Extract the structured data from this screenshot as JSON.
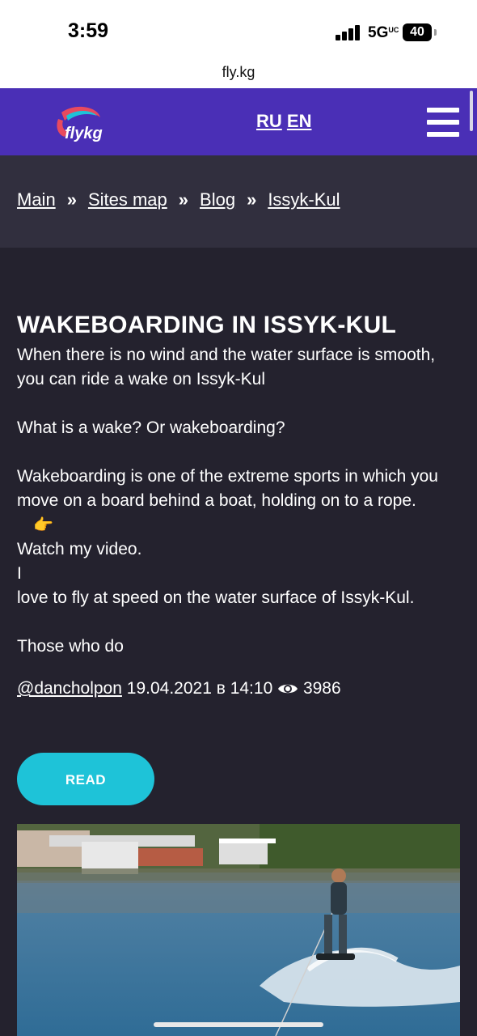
{
  "status_bar": {
    "time": "3:59",
    "network": "5G",
    "network_suffix": "UC",
    "battery": "40"
  },
  "browser": {
    "url": "fly.kg"
  },
  "header": {
    "logo_text": "FLYKG",
    "lang_ru": "RU",
    "lang_en": "EN",
    "menu_icon": "hamburger-menu-icon",
    "bg_color": "#4a2fb6"
  },
  "breadcrumb": {
    "items": [
      "Main",
      "Sites map",
      "Blog",
      "Issyk-Kul"
    ],
    "separator": "»"
  },
  "article": {
    "title": "WAKEBOARDING IN ISSYK-KUL",
    "p1": "When there is no wind and the water surface is smooth, you can ride a wake on Issyk-Kul",
    "p2": "What is a wake? Or wakeboarding?",
    "p3": "Wakeboarding is one of the extreme sports in which you move on a board behind a boat, holding on to a rope.",
    "emoji": "👉",
    "p4": "Watch my video.",
    "p5": "I",
    "p6": "love to fly at speed on the water surface of Issyk-Kul.",
    "p7": "Those who do",
    "author": "@dancholpon",
    "date": "19.04.2021 в 14:10",
    "views": "3986",
    "read_label": "READ",
    "accent_color": "#1ec3d8"
  }
}
